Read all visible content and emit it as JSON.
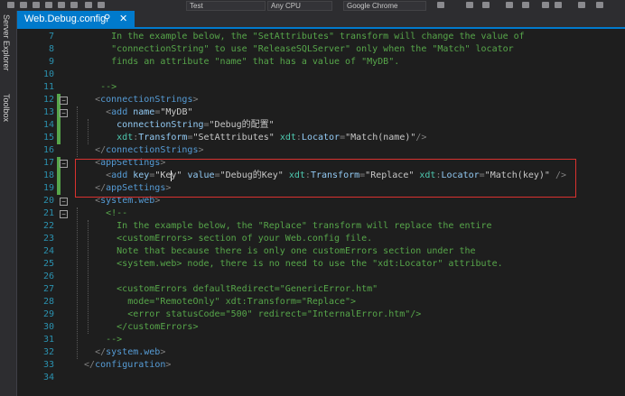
{
  "toolbar": {
    "config_box": "Test",
    "platform_box": "Any CPU",
    "browser_box": "Google Chrome"
  },
  "sidebar": {
    "server_explorer": "Server Explorer",
    "toolbox": "Toolbox"
  },
  "tab": {
    "title": "Web.Debug.config",
    "pin_glyph": "⚲",
    "close_glyph": "✕"
  },
  "editor": {
    "line_numbers": [
      "7",
      "8",
      "9",
      "10",
      "11",
      "12",
      "13",
      "14",
      "15",
      "16",
      "17",
      "18",
      "19",
      "20",
      "21",
      "22",
      "23",
      "24",
      "25",
      "26",
      "27",
      "28",
      "29",
      "30",
      "31",
      "32",
      "33",
      "34"
    ],
    "lines": [
      [
        [
          "cmt",
          "       In the example below, the \"SetAttributes\" transform will change the value of"
        ]
      ],
      [
        [
          "cmt",
          "       \"connectionString\" to use \"ReleaseSQLServer\" only when the \"Match\" locator"
        ]
      ],
      [
        [
          "cmt",
          "       finds an attribute \"name\" that has a value of \"MyDB\"."
        ]
      ],
      [
        [
          "cmt",
          ""
        ]
      ],
      [
        [
          "cmt",
          "     -->"
        ]
      ],
      [
        [
          "delim",
          "    <"
        ],
        [
          "tag",
          "connectionStrings"
        ],
        [
          "delim",
          ">"
        ]
      ],
      [
        [
          "delim",
          "      <"
        ],
        [
          "tag",
          "add"
        ],
        [
          "attr",
          " name"
        ],
        [
          "delim",
          "="
        ],
        [
          "val",
          "\"MyDB\""
        ]
      ],
      [
        [
          "attr",
          "        connectionString"
        ],
        [
          "delim",
          "="
        ],
        [
          "val",
          "\"Debug的配置\""
        ]
      ],
      [
        [
          "ns",
          "        xdt"
        ],
        [
          "delim",
          ":"
        ],
        [
          "attr",
          "Transform"
        ],
        [
          "delim",
          "="
        ],
        [
          "val",
          "\"SetAttributes\""
        ],
        [
          "ns",
          " xdt"
        ],
        [
          "delim",
          ":"
        ],
        [
          "attr",
          "Locator"
        ],
        [
          "delim",
          "="
        ],
        [
          "val",
          "\"Match(name)\""
        ],
        [
          "delim",
          "/>"
        ]
      ],
      [
        [
          "delim",
          "    </"
        ],
        [
          "tag",
          "connectionStrings"
        ],
        [
          "delim",
          ">"
        ]
      ],
      [
        [
          "delim",
          "    <"
        ],
        [
          "tag",
          "appSettings"
        ],
        [
          "delim",
          ">"
        ]
      ],
      [
        [
          "delim",
          "      <"
        ],
        [
          "tag",
          "add"
        ],
        [
          "attr",
          " key"
        ],
        [
          "delim",
          "="
        ],
        [
          "val",
          "\"Key\""
        ],
        [
          "attr",
          " value"
        ],
        [
          "delim",
          "="
        ],
        [
          "val",
          "\"Debug的Key\""
        ],
        [
          "ns",
          " xdt"
        ],
        [
          "delim",
          ":"
        ],
        [
          "attr",
          "Transform"
        ],
        [
          "delim",
          "="
        ],
        [
          "val",
          "\"Replace\""
        ],
        [
          "ns",
          " xdt"
        ],
        [
          "delim",
          ":"
        ],
        [
          "attr",
          "Locator"
        ],
        [
          "delim",
          "="
        ],
        [
          "val",
          "\"Match(key)\""
        ],
        [
          "delim",
          " />"
        ]
      ],
      [
        [
          "delim",
          "    </"
        ],
        [
          "tag",
          "appSettings"
        ],
        [
          "delim",
          ">"
        ]
      ],
      [
        [
          "delim",
          "    <"
        ],
        [
          "tag",
          "system.web"
        ],
        [
          "delim",
          ">"
        ]
      ],
      [
        [
          "cmt",
          "      <!--"
        ]
      ],
      [
        [
          "cmt",
          "        In the example below, the \"Replace\" transform will replace the entire"
        ]
      ],
      [
        [
          "cmt",
          "        <customErrors> section of your Web.config file."
        ]
      ],
      [
        [
          "cmt",
          "        Note that because there is only one customErrors section under the"
        ]
      ],
      [
        [
          "cmt",
          "        <system.web> node, there is no need to use the \"xdt:Locator\" attribute."
        ]
      ],
      [
        [
          "cmt",
          ""
        ]
      ],
      [
        [
          "cmt",
          "        <customErrors defaultRedirect=\"GenericError.htm\""
        ]
      ],
      [
        [
          "cmt",
          "          mode=\"RemoteOnly\" xdt:Transform=\"Replace\">"
        ]
      ],
      [
        [
          "cmt",
          "          <error statusCode=\"500\" redirect=\"InternalError.htm\"/>"
        ]
      ],
      [
        [
          "cmt",
          "        </customErrors>"
        ]
      ],
      [
        [
          "cmt",
          "      -->"
        ]
      ],
      [
        [
          "delim",
          "    </"
        ],
        [
          "tag",
          "system.web"
        ],
        [
          "delim",
          ">"
        ]
      ],
      [
        [
          "delim",
          "  </"
        ],
        [
          "tag",
          "configuration"
        ],
        [
          "delim",
          ">"
        ]
      ],
      [
        [
          "cmt",
          ""
        ]
      ]
    ]
  },
  "colors": {
    "accent": "#007acc",
    "highlight_box": "#d9322f",
    "change_bar": "#57a64a",
    "comment": "#57a64a",
    "tag": "#569cd6",
    "attribute": "#92caf4",
    "line_number": "#2b91af"
  }
}
